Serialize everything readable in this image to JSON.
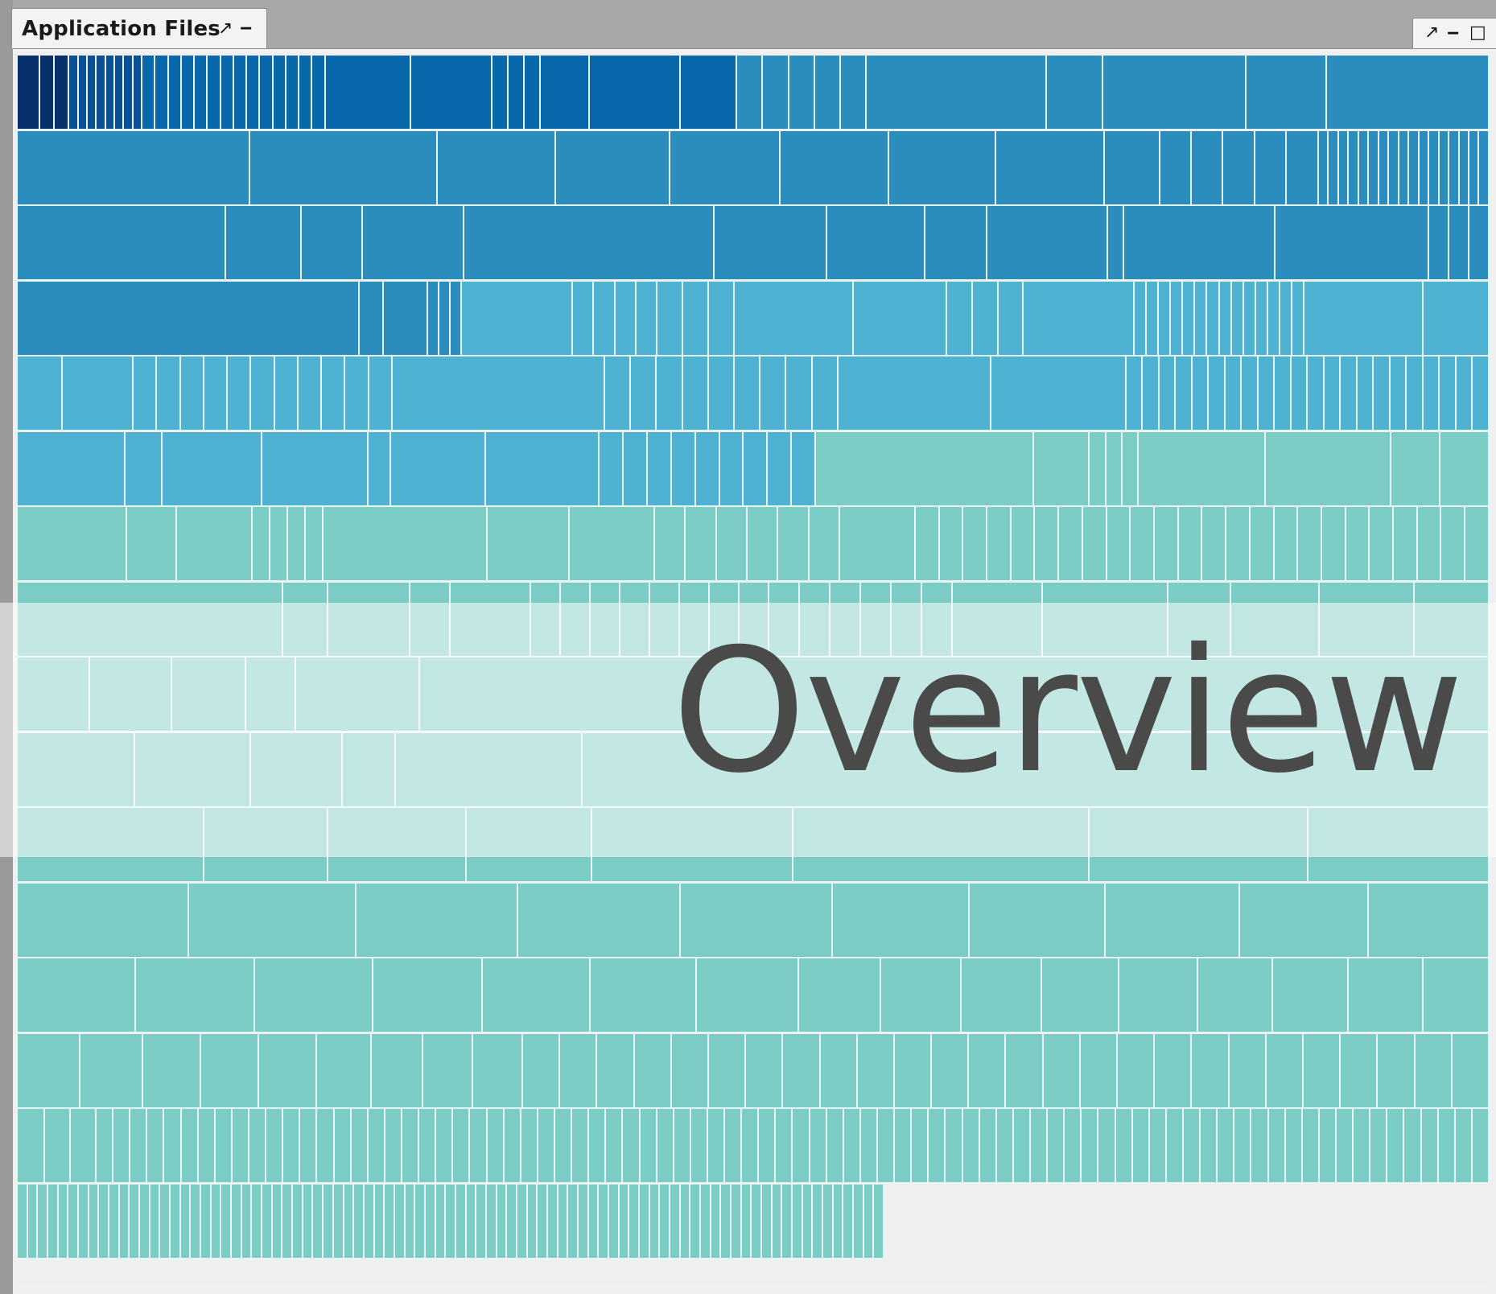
{
  "tab": {
    "title": "Application Files",
    "popout_glyph": "↗",
    "minimize_glyph": "‒"
  },
  "window_controls": {
    "restore_glyph": "↗",
    "minimize_glyph": "‒",
    "maximize_glyph": "□"
  },
  "overlay": {
    "title": "Overview"
  },
  "colors": {
    "darkest_blue": "#08306b",
    "dark_blue": "#0b4f95",
    "blue": "#0868ac",
    "mid_blue": "#2b8cbe",
    "light_blue": "#4eb3d3",
    "teal": "#7bccc4",
    "cell_border": "#e8f4f6",
    "empty": "#efefef"
  },
  "treemap": {
    "rows": [
      {
        "name": "row-1",
        "segments": [
          {
            "color": "#08306b",
            "count": 1,
            "share": 28
          },
          {
            "color": "#08306b",
            "count": 2,
            "share": 36
          },
          {
            "color": "#0b4f95",
            "count": 8,
            "share": 90
          },
          {
            "color": "#0868ac",
            "count": 14,
            "share": 226
          },
          {
            "color": "#0868ac",
            "count": 1,
            "share": 106
          },
          {
            "color": "#0868ac",
            "count": 1,
            "share": 100
          },
          {
            "color": "#0868ac",
            "count": 3,
            "share": 60
          },
          {
            "color": "#0868ac",
            "count": 1,
            "share": 60
          },
          {
            "color": "#0868ac",
            "count": 1,
            "share": 112
          },
          {
            "color": "#0868ac",
            "count": 1,
            "share": 70
          },
          {
            "color": "#2b8cbe",
            "count": 5,
            "share": 160
          },
          {
            "color": "#2b8cbe",
            "count": 1,
            "share": 222
          },
          {
            "color": "#2b8cbe",
            "count": 1,
            "share": 70
          },
          {
            "color": "#2b8cbe",
            "count": 1,
            "share": 176
          },
          {
            "color": "#2b8cbe",
            "count": 1,
            "share": 100
          },
          {
            "color": "#2b8cbe",
            "count": 1,
            "share": 200
          }
        ]
      },
      {
        "name": "row-2",
        "segments": [
          {
            "color": "#2b8cbe",
            "count": 1,
            "share": 278
          },
          {
            "color": "#2b8cbe",
            "count": 1,
            "share": 224
          },
          {
            "color": "#2b8cbe",
            "count": 1,
            "share": 142
          },
          {
            "color": "#2b8cbe",
            "count": 1,
            "share": 136
          },
          {
            "color": "#2b8cbe",
            "count": 1,
            "share": 132
          },
          {
            "color": "#2b8cbe",
            "count": 1,
            "share": 130
          },
          {
            "color": "#2b8cbe",
            "count": 1,
            "share": 128
          },
          {
            "color": "#2b8cbe",
            "count": 1,
            "share": 130
          },
          {
            "color": "#2b8cbe",
            "count": 1,
            "share": 66
          },
          {
            "color": "#2b8cbe",
            "count": 5,
            "share": 190
          },
          {
            "color": "#2b8cbe",
            "count": 17,
            "share": 204
          }
        ]
      },
      {
        "name": "row-3",
        "segments": [
          {
            "color": "#2b8cbe",
            "count": 1,
            "share": 258
          },
          {
            "color": "#2b8cbe",
            "count": 1,
            "share": 94
          },
          {
            "color": "#2b8cbe",
            "count": 1,
            "share": 76
          },
          {
            "color": "#2b8cbe",
            "count": 1,
            "share": 126
          },
          {
            "color": "#2b8cbe",
            "count": 1,
            "share": 310
          },
          {
            "color": "#2b8cbe",
            "count": 1,
            "share": 140
          },
          {
            "color": "#2b8cbe",
            "count": 1,
            "share": 122
          },
          {
            "color": "#2b8cbe",
            "count": 1,
            "share": 76
          },
          {
            "color": "#2b8cbe",
            "count": 1,
            "share": 150
          },
          {
            "color": "#2b8cbe",
            "count": 1,
            "share": 20
          },
          {
            "color": "#2b8cbe",
            "count": 1,
            "share": 188
          },
          {
            "color": "#2b8cbe",
            "count": 1,
            "share": 190
          },
          {
            "color": "#2b8cbe",
            "count": 3,
            "share": 75
          }
        ]
      },
      {
        "name": "row-4",
        "segments": [
          {
            "color": "#2b8cbe",
            "count": 1,
            "share": 402
          },
          {
            "color": "#2b8cbe",
            "count": 1,
            "share": 28
          },
          {
            "color": "#2b8cbe",
            "count": 1,
            "share": 52
          },
          {
            "color": "#2b8cbe",
            "count": 3,
            "share": 40
          },
          {
            "color": "#4eb3d3",
            "count": 1,
            "share": 130
          },
          {
            "color": "#4eb3d3",
            "count": 4,
            "share": 100
          },
          {
            "color": "#4eb3d3",
            "count": 3,
            "share": 90
          },
          {
            "color": "#4eb3d3",
            "count": 1,
            "share": 140
          },
          {
            "color": "#4eb3d3",
            "count": 1,
            "share": 110
          },
          {
            "color": "#4eb3d3",
            "count": 3,
            "share": 90
          },
          {
            "color": "#4eb3d3",
            "count": 1,
            "share": 130
          },
          {
            "color": "#4eb3d3",
            "count": 14,
            "share": 200
          },
          {
            "color": "#4eb3d3",
            "count": 1,
            "share": 140
          },
          {
            "color": "#4eb3d3",
            "count": 1,
            "share": 77
          }
        ]
      },
      {
        "name": "row-5",
        "segments": [
          {
            "color": "#4eb3d3",
            "count": 1,
            "share": 56
          },
          {
            "color": "#4eb3d3",
            "count": 1,
            "share": 88
          },
          {
            "color": "#4eb3d3",
            "count": 11,
            "share": 322
          },
          {
            "color": "#4eb3d3",
            "count": 1,
            "share": 264
          },
          {
            "color": "#4eb3d3",
            "count": 9,
            "share": 290
          },
          {
            "color": "#4eb3d3",
            "count": 1,
            "share": 190
          },
          {
            "color": "#4eb3d3",
            "count": 1,
            "share": 168
          },
          {
            "color": "#4eb3d3",
            "count": 22,
            "share": 451
          }
        ]
      },
      {
        "name": "row-6",
        "segments": [
          {
            "color": "#4eb3d3",
            "count": 1,
            "share": 132
          },
          {
            "color": "#4eb3d3",
            "count": 1,
            "share": 46
          },
          {
            "color": "#4eb3d3",
            "count": 1,
            "share": 122
          },
          {
            "color": "#4eb3d3",
            "count": 1,
            "share": 130
          },
          {
            "color": "#4eb3d3",
            "count": 1,
            "share": 28
          },
          {
            "color": "#4eb3d3",
            "count": 1,
            "share": 116
          },
          {
            "color": "#4eb3d3",
            "count": 1,
            "share": 140
          },
          {
            "color": "#4eb3d3",
            "count": 9,
            "share": 265
          },
          {
            "color": "#7bccc4",
            "count": 1,
            "share": 268
          },
          {
            "color": "#7bccc4",
            "count": 1,
            "share": 68
          },
          {
            "color": "#7bccc4",
            "count": 3,
            "share": 60
          },
          {
            "color": "#7bccc4",
            "count": 1,
            "share": 156
          },
          {
            "color": "#7bccc4",
            "count": 1,
            "share": 154
          },
          {
            "color": "#7bccc4",
            "count": 1,
            "share": 60
          },
          {
            "color": "#7bccc4",
            "count": 1,
            "share": 60
          }
        ]
      },
      {
        "name": "row-7",
        "segments": [
          {
            "color": "#7bccc4",
            "count": 1,
            "share": 136
          },
          {
            "color": "#7bccc4",
            "count": 1,
            "share": 62
          },
          {
            "color": "#7bccc4",
            "count": 1,
            "share": 94
          },
          {
            "color": "#7bccc4",
            "count": 4,
            "share": 88
          },
          {
            "color": "#7bccc4",
            "count": 1,
            "share": 204
          },
          {
            "color": "#7bccc4",
            "count": 1,
            "share": 102
          },
          {
            "color": "#7bccc4",
            "count": 1,
            "share": 106
          },
          {
            "color": "#7bccc4",
            "count": 6,
            "share": 230
          },
          {
            "color": "#7bccc4",
            "count": 1,
            "share": 94
          },
          {
            "color": "#7bccc4",
            "count": 24,
            "share": 713
          }
        ]
      },
      {
        "name": "row-8",
        "segments": [
          {
            "color": "#7bccc4",
            "count": 1,
            "share": 330
          },
          {
            "color": "#7bccc4",
            "count": 1,
            "share": 56
          },
          {
            "color": "#7bccc4",
            "count": 1,
            "share": 102
          },
          {
            "color": "#7bccc4",
            "count": 1,
            "share": 50
          },
          {
            "color": "#7bccc4",
            "count": 1,
            "share": 100
          },
          {
            "color": "#7bccc4",
            "count": 8,
            "share": 296
          },
          {
            "color": "#7bccc4",
            "count": 6,
            "share": 228
          },
          {
            "color": "#7bccc4",
            "count": 1,
            "share": 112
          },
          {
            "color": "#7bccc4",
            "count": 1,
            "share": 156
          },
          {
            "color": "#7bccc4",
            "count": 1,
            "share": 78
          },
          {
            "color": "#7bccc4",
            "count": 1,
            "share": 110
          },
          {
            "color": "#7bccc4",
            "count": 1,
            "share": 118
          },
          {
            "color": "#7bccc4",
            "count": 1,
            "share": 93
          }
        ]
      },
      {
        "name": "row-9",
        "segments": [
          {
            "color": "#7bccc4",
            "count": 1,
            "share": 90
          },
          {
            "color": "#7bccc4",
            "count": 1,
            "share": 102
          },
          {
            "color": "#7bccc4",
            "count": 1,
            "share": 92
          },
          {
            "color": "#7bccc4",
            "count": 1,
            "share": 62
          },
          {
            "color": "#7bccc4",
            "count": 1,
            "share": 154
          },
          {
            "color": "#7bccc4",
            "count": 1,
            "share": 1329
          }
        ]
      },
      {
        "name": "row-10",
        "segments": [
          {
            "color": "#7bccc4",
            "count": 1,
            "share": 146
          },
          {
            "color": "#7bccc4",
            "count": 1,
            "share": 144
          },
          {
            "color": "#7bccc4",
            "count": 1,
            "share": 114
          },
          {
            "color": "#7bccc4",
            "count": 1,
            "share": 66
          },
          {
            "color": "#7bccc4",
            "count": 1,
            "share": 232
          },
          {
            "color": "#7bccc4",
            "count": 1,
            "share": 1127
          }
        ]
      },
      {
        "name": "row-11",
        "segments": [
          {
            "color": "#7bccc4",
            "count": 1,
            "share": 232
          },
          {
            "color": "#7bccc4",
            "count": 1,
            "share": 154
          },
          {
            "color": "#7bccc4",
            "count": 1,
            "share": 172
          },
          {
            "color": "#7bccc4",
            "count": 1,
            "share": 156
          },
          {
            "color": "#7bccc4",
            "count": 1,
            "share": 250
          },
          {
            "color": "#7bccc4",
            "count": 1,
            "share": 368
          },
          {
            "color": "#7bccc4",
            "count": 1,
            "share": 272
          },
          {
            "color": "#7bccc4",
            "count": 1,
            "share": 225
          }
        ]
      },
      {
        "name": "row-12",
        "segments": [
          {
            "color": "#7bccc4",
            "count": 1,
            "share": 194
          },
          {
            "color": "#7bccc4",
            "count": 1,
            "share": 190
          },
          {
            "color": "#7bccc4",
            "count": 1,
            "share": 184
          },
          {
            "color": "#7bccc4",
            "count": 1,
            "share": 184
          },
          {
            "color": "#7bccc4",
            "count": 1,
            "share": 172
          },
          {
            "color": "#7bccc4",
            "count": 1,
            "share": 156
          },
          {
            "color": "#7bccc4",
            "count": 1,
            "share": 154
          },
          {
            "color": "#7bccc4",
            "count": 1,
            "share": 152
          },
          {
            "color": "#7bccc4",
            "count": 1,
            "share": 146
          },
          {
            "color": "#7bccc4",
            "count": 1,
            "share": 137
          }
        ]
      },
      {
        "name": "row-13",
        "segments": [
          {
            "color": "#7bccc4",
            "count": 1,
            "share": 138
          },
          {
            "color": "#7bccc4",
            "count": 1,
            "share": 140
          },
          {
            "color": "#7bccc4",
            "count": 1,
            "share": 138
          },
          {
            "color": "#7bccc4",
            "count": 1,
            "share": 128
          },
          {
            "color": "#7bccc4",
            "count": 1,
            "share": 126
          },
          {
            "color": "#7bccc4",
            "count": 1,
            "share": 124
          },
          {
            "color": "#7bccc4",
            "count": 1,
            "share": 120
          },
          {
            "color": "#7bccc4",
            "count": 1,
            "share": 96
          },
          {
            "color": "#7bccc4",
            "count": 1,
            "share": 94
          },
          {
            "color": "#7bccc4",
            "count": 1,
            "share": 94
          },
          {
            "color": "#7bccc4",
            "count": 1,
            "share": 90
          },
          {
            "color": "#7bccc4",
            "count": 1,
            "share": 92
          },
          {
            "color": "#7bccc4",
            "count": 1,
            "share": 88
          },
          {
            "color": "#7bccc4",
            "count": 1,
            "share": 88
          },
          {
            "color": "#7bccc4",
            "count": 1,
            "share": 88
          },
          {
            "color": "#7bccc4",
            "count": 1,
            "share": 77
          }
        ]
      },
      {
        "name": "row-14",
        "segments": [
          {
            "color": "#7bccc4",
            "count": 1,
            "share": 78
          },
          {
            "color": "#7bccc4",
            "count": 1,
            "share": 78
          },
          {
            "color": "#7bccc4",
            "count": 1,
            "share": 72
          },
          {
            "color": "#7bccc4",
            "count": 1,
            "share": 72
          },
          {
            "color": "#7bccc4",
            "count": 1,
            "share": 72
          },
          {
            "color": "#7bccc4",
            "count": 1,
            "share": 68
          },
          {
            "color": "#7bccc4",
            "count": 1,
            "share": 64
          },
          {
            "color": "#7bccc4",
            "count": 1,
            "share": 62
          },
          {
            "color": "#7bccc4",
            "count": 1,
            "share": 62
          },
          {
            "color": "#7bccc4",
            "count": 26,
            "share": 1201
          }
        ]
      },
      {
        "name": "row-15",
        "segments": [
          {
            "color": "#7bccc4",
            "count": 1,
            "share": 34
          },
          {
            "color": "#7bccc4",
            "count": 1,
            "share": 32
          },
          {
            "color": "#7bccc4",
            "count": 1,
            "share": 32
          },
          {
            "color": "#7bccc4",
            "count": 82,
            "share": 1731
          }
        ]
      },
      {
        "name": "row-16",
        "segments": [
          {
            "color": "#7bccc4",
            "count": 85,
            "share": 1078
          },
          {
            "color": "#efefef",
            "count": 1,
            "share": 751
          }
        ]
      }
    ]
  }
}
